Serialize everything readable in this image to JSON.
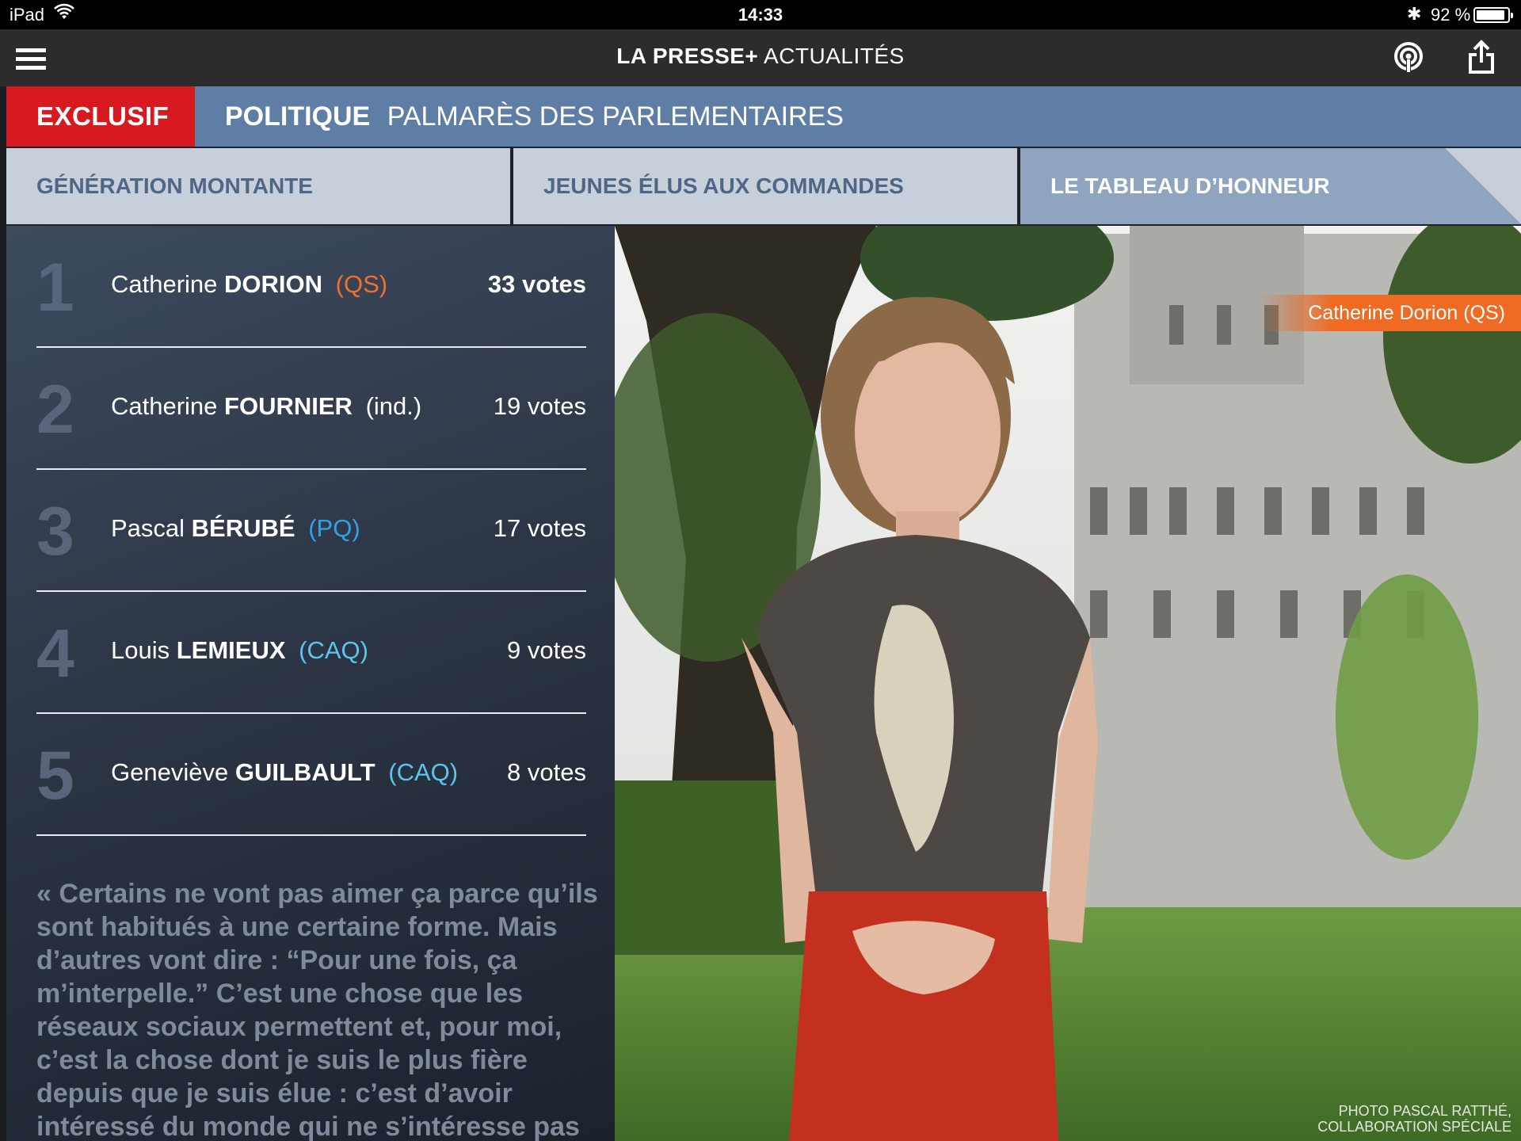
{
  "status_bar": {
    "carrier": "iPad",
    "time": "14:33",
    "battery": "92 %",
    "battery_level": 0.92,
    "icons": [
      "wifi-icon",
      "bluetooth-icon",
      "battery-icon"
    ]
  },
  "header": {
    "brand": "LA PRESSE+",
    "section": "ACTUALITÉS",
    "icons": [
      "menu-icon",
      "radio-icon",
      "share-icon"
    ]
  },
  "section_bar": {
    "tag": "EXCLUSIF",
    "category": "POLITIQUE",
    "title": "PALMARÈS DES PARLEMENTAIRES"
  },
  "tabs": [
    {
      "label": "GÉNÉRATION MONTANTE"
    },
    {
      "label": "JEUNES ÉLUS AUX COMMANDES"
    },
    {
      "label": "LE TABLEAU D’HONNEUR"
    }
  ],
  "ranking": [
    {
      "rank": "1",
      "first": "Catherine",
      "last": "DORION",
      "party": "(QS)",
      "party_color": "#f0702a",
      "votes": "33 votes"
    },
    {
      "rank": "2",
      "first": "Catherine",
      "last": "FOURNIER",
      "party": "(ind.)",
      "party_color": "#ffffff",
      "votes": "19 votes"
    },
    {
      "rank": "3",
      "first": "Pascal",
      "last": "BÉRUBÉ",
      "party": "(PQ)",
      "party_color": "#2ea3e6",
      "votes": "17 votes"
    },
    {
      "rank": "4",
      "first": "Louis",
      "last": "LEMIEUX",
      "party": "(CAQ)",
      "party_color": "#5cc5ee",
      "votes": "9 votes"
    },
    {
      "rank": "5",
      "first": "Geneviève",
      "last": "GUILBAULT",
      "party": "(CAQ)",
      "party_color": "#5cc5ee",
      "votes": "8 votes"
    }
  ],
  "quote": "« Certains ne vont pas aimer ça parce qu’ils sont habitués à une certaine forme. Mais d’autres vont dire : “Pour une fois, ça m’interpelle.” C’est une chose que les réseaux sociaux permettent et, pour moi, c’est la chose dont je suis le plus fière depuis que je suis élue : c’est d’avoir intéressé du monde qui ne s’intéresse pas",
  "photo": {
    "caption": "Catherine Dorion (QS)",
    "credit_line1": "PHOTO PASCAL RATTHÉ,",
    "credit_line2": "COLLABORATION SPÉCIALE"
  },
  "colors": {
    "exclusif": "#d71920",
    "section_bar": "#5f7ea6",
    "caption_tag": "#ef6a22"
  }
}
